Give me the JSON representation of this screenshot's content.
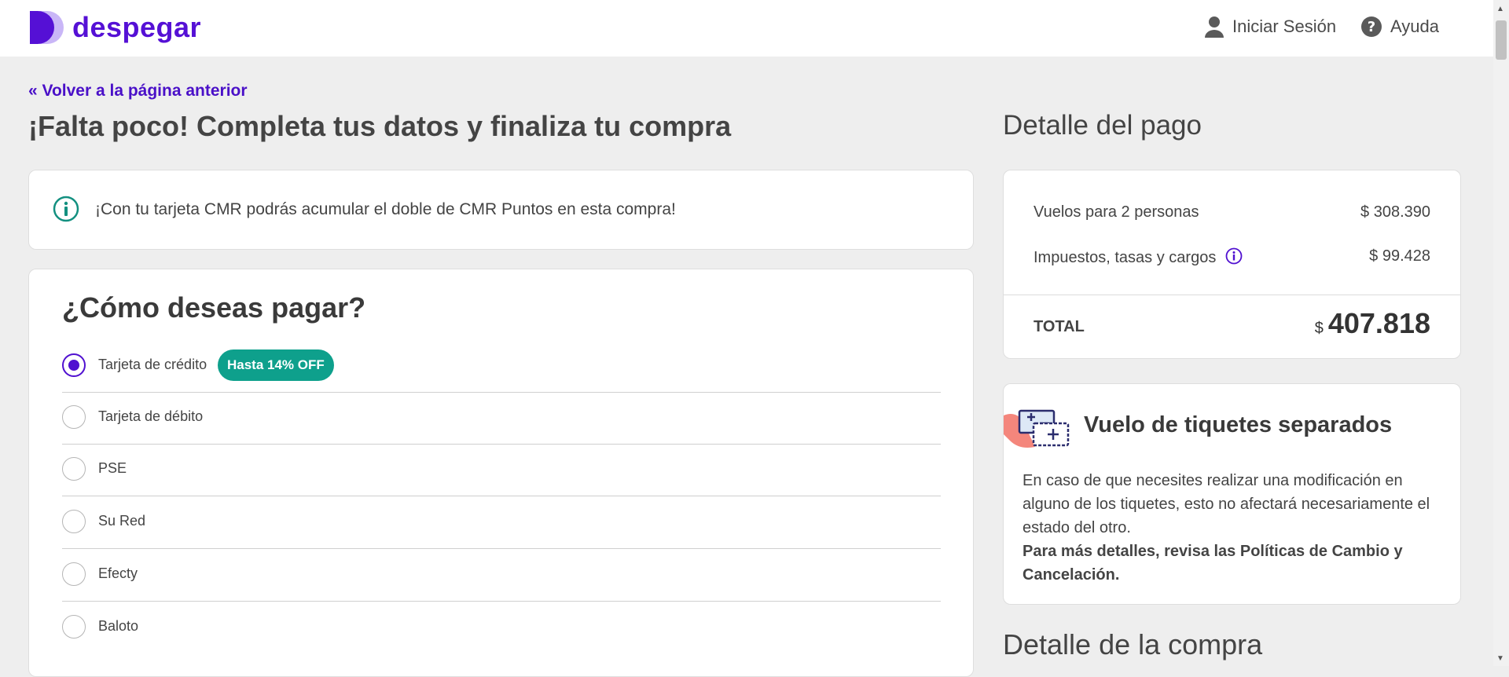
{
  "header": {
    "brand": "despegar",
    "login_label": "Iniciar Sesión",
    "help_label": "Ayuda"
  },
  "nav": {
    "back_label": "« Volver a la página anterior"
  },
  "main": {
    "title": "¡Falta poco! Completa tus datos y finaliza tu compra",
    "banner_text": "¡Con tu tarjeta CMR podrás acumular el doble de CMR Puntos en esta compra!",
    "payment": {
      "title": "¿Cómo deseas pagar?",
      "options": [
        {
          "label": "Tarjeta de crédito",
          "selected": true,
          "badge": "Hasta 14% OFF"
        },
        {
          "label": "Tarjeta de débito",
          "selected": false
        },
        {
          "label": "PSE",
          "selected": false
        },
        {
          "label": "Su Red",
          "selected": false
        },
        {
          "label": "Efecty",
          "selected": false
        },
        {
          "label": "Baloto",
          "selected": false
        }
      ]
    }
  },
  "summary": {
    "title": "Detalle del pago",
    "rows": [
      {
        "label": "Vuelos para 2 personas",
        "amount": "$ 308.390"
      },
      {
        "label": "Impuestos, tasas y cargos",
        "amount": "$ 99.428"
      }
    ],
    "total_label": "TOTAL",
    "total_currency": "$",
    "total_amount": "407.818"
  },
  "tickets": {
    "title": "Vuelo de tiquetes separados",
    "body": "En caso de que necesites realizar una modificación en alguno de los tiquetes, esto no afectará necesariamente el estado del otro.",
    "body_strong": "Para más detalles, revisa las Políticas de Cambio y Cancelación."
  },
  "purchase_detail": {
    "title": "Detalle de la compra"
  },
  "colors": {
    "brand": "#5510d5",
    "badge": "#0ea08c",
    "info_icon": "#139080"
  },
  "icons": [
    "despegar-logo",
    "user-icon",
    "help-icon",
    "info-icon",
    "info-circle-icon",
    "tickets-icon"
  ]
}
